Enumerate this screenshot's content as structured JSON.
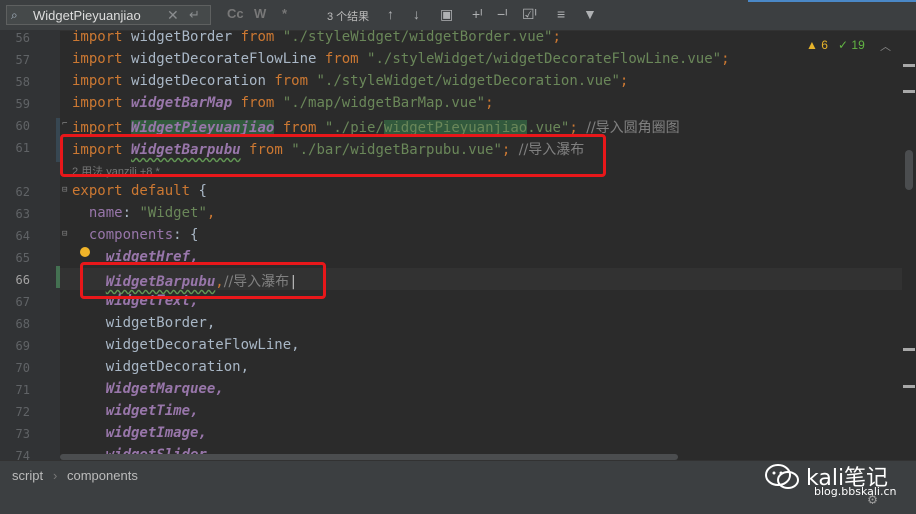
{
  "find": {
    "query": "WidgetPieyuanjiao",
    "clear_icon": "close-icon",
    "match_case": "Cc",
    "whole_words": "W",
    "regex": "*",
    "results": "3 个结果"
  },
  "gutter": {
    "lines": [
      "56",
      "57",
      "58",
      "59",
      "60",
      "61",
      "",
      "62",
      "63",
      "64",
      "65",
      "66",
      "67",
      "68",
      "69",
      "70",
      "71",
      "72",
      "73",
      "74"
    ],
    "current": "66"
  },
  "code": {
    "l56": {
      "kw": "import",
      "name": "widgetBorder",
      "from": "from",
      "path": "\"./styleWidget/widgetBorder.vue\"",
      "end": ";"
    },
    "l57": {
      "kw": "import",
      "name": "widgetDecorateFlowLine",
      "from": "from",
      "path": "\"./styleWidget/widgetDecorateFlowLine.vue\"",
      "end": ";"
    },
    "l58": {
      "kw": "import",
      "name": "widgetDecoration",
      "from": "from",
      "path": "\"./styleWidget/widgetDecoration.vue\"",
      "end": ";"
    },
    "l59": {
      "kw": "import",
      "name": "widgetBarMap",
      "from": "from",
      "path": "\"./map/widgetBarMap.vue\"",
      "end": ";"
    },
    "l60": {
      "kw": "import",
      "name": "WidgetPieyuanjiao",
      "from": "from",
      "path_a": "\"./pie/",
      "path_b": "widgetPieyuanjiao",
      "path_c": ".vue\"",
      "end": ";",
      "comment": "//导入圆角圈图"
    },
    "l61": {
      "kw": "import",
      "name": "WidgetBarpubu",
      "from": "from",
      "path": "\"./bar/widgetBarpubu.vue\"",
      "end": ";",
      "comment": "//导入瀑布"
    },
    "hint": "2 用法   yanzili +8 *",
    "l62": {
      "kw": "export default",
      "brace": "{"
    },
    "l63": {
      "key": "name",
      "value": "\"Widget\"",
      "end": ","
    },
    "l64": {
      "key": "components",
      "brace": "{"
    },
    "l65": "widgetHref,",
    "l66": {
      "name": "WidgetBarpubu",
      "end": ",",
      "comment": "//导入瀑布"
    },
    "l67": "widgetText,",
    "l68": "widgetBorder,",
    "l69": "widgetDecorateFlowLine,",
    "l70": "widgetDecoration,",
    "l71": "WidgetMarquee,",
    "l72": "widgetTime,",
    "l73": "widgetImage,",
    "l74": "widgetSlider,"
  },
  "inspections": {
    "warnings": "6",
    "ok": "19"
  },
  "breadcrumb": [
    "script",
    "components"
  ],
  "watermark": {
    "title": "kali笔记",
    "url": "blog.bbskali.cn"
  },
  "colors": {
    "accent": "#4a88c7",
    "highlight": "#e8171a"
  }
}
